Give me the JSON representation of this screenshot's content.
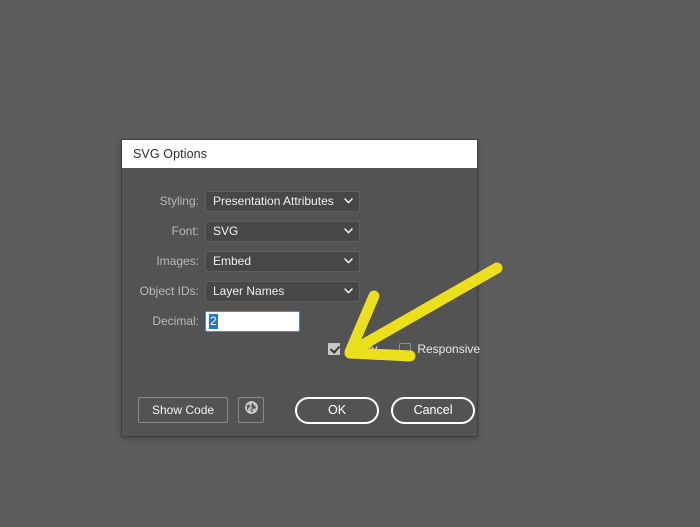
{
  "window": {
    "title": "SVG Options"
  },
  "form": {
    "fields": [
      {
        "label": "Styling:",
        "value": "Presentation Attributes",
        "control": "select",
        "icon": "chevron-down-icon",
        "name": "styling"
      },
      {
        "label": "Font:",
        "value": "SVG",
        "control": "select",
        "icon": "chevron-down-icon",
        "name": "font"
      },
      {
        "label": "Images:",
        "value": "Embed",
        "control": "select",
        "icon": "chevron-down-icon",
        "name": "images"
      },
      {
        "label": "Object IDs:",
        "value": "Layer Names",
        "control": "select",
        "icon": "chevron-down-icon",
        "name": "object-ids"
      }
    ],
    "decimal": {
      "label": "Decimal:",
      "value": "2",
      "selected": true
    },
    "checkboxes": [
      {
        "label": "Minify",
        "checked": true
      },
      {
        "label": "Responsive",
        "checked": false
      }
    ]
  },
  "footer": {
    "show_code_label": "Show Code",
    "preview_icon": "globe-icon",
    "ok_label": "OK",
    "cancel_label": "Cancel"
  },
  "annotation": {
    "type": "arrow",
    "color": "#ece01c",
    "points_to": "Responsive"
  },
  "colors": {
    "desktop_background": "#5d5d5d",
    "dialog_background": "#535353",
    "titlebar_background": "#ffffff",
    "accent_focus": "#3c8ddb",
    "selection_highlight": "#2a73c9",
    "annotation_yellow": "#ece01c"
  }
}
